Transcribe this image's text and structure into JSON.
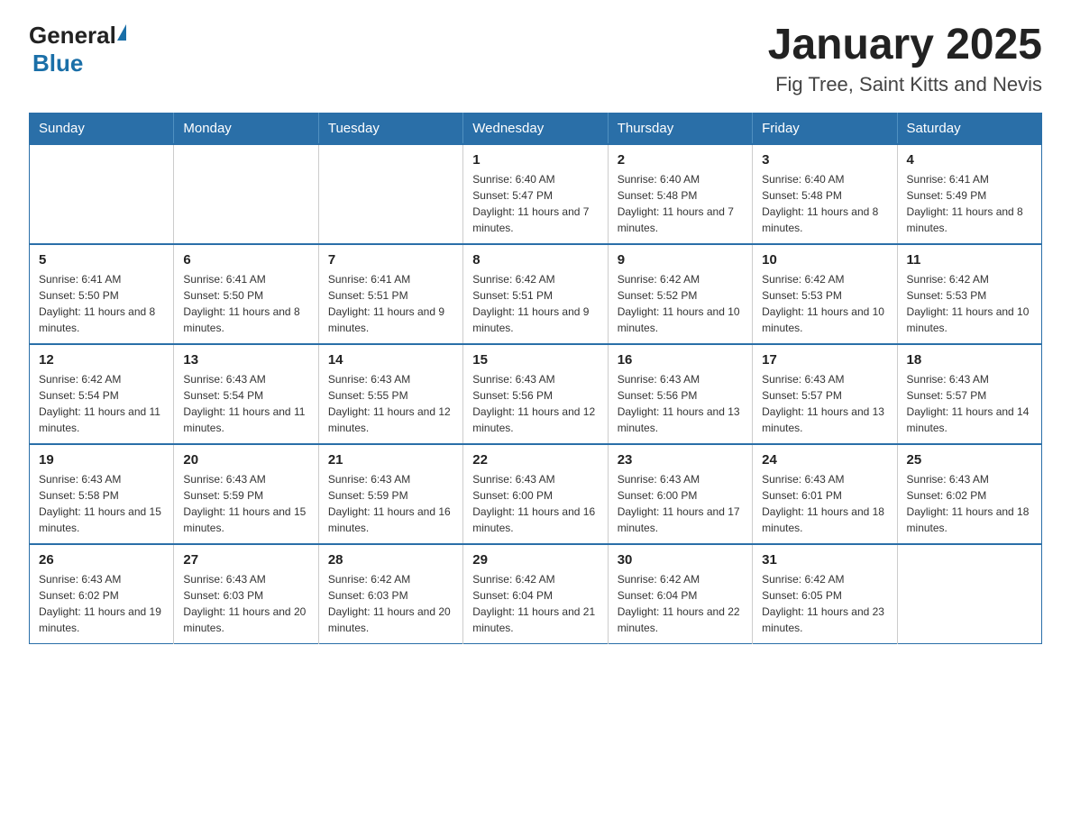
{
  "logo": {
    "general": "General",
    "blue": "Blue"
  },
  "header": {
    "month": "January 2025",
    "location": "Fig Tree, Saint Kitts and Nevis"
  },
  "days_of_week": [
    "Sunday",
    "Monday",
    "Tuesday",
    "Wednesday",
    "Thursday",
    "Friday",
    "Saturday"
  ],
  "weeks": [
    [
      {
        "day": "",
        "info": ""
      },
      {
        "day": "",
        "info": ""
      },
      {
        "day": "",
        "info": ""
      },
      {
        "day": "1",
        "info": "Sunrise: 6:40 AM\nSunset: 5:47 PM\nDaylight: 11 hours and 7 minutes."
      },
      {
        "day": "2",
        "info": "Sunrise: 6:40 AM\nSunset: 5:48 PM\nDaylight: 11 hours and 7 minutes."
      },
      {
        "day": "3",
        "info": "Sunrise: 6:40 AM\nSunset: 5:48 PM\nDaylight: 11 hours and 8 minutes."
      },
      {
        "day": "4",
        "info": "Sunrise: 6:41 AM\nSunset: 5:49 PM\nDaylight: 11 hours and 8 minutes."
      }
    ],
    [
      {
        "day": "5",
        "info": "Sunrise: 6:41 AM\nSunset: 5:50 PM\nDaylight: 11 hours and 8 minutes."
      },
      {
        "day": "6",
        "info": "Sunrise: 6:41 AM\nSunset: 5:50 PM\nDaylight: 11 hours and 8 minutes."
      },
      {
        "day": "7",
        "info": "Sunrise: 6:41 AM\nSunset: 5:51 PM\nDaylight: 11 hours and 9 minutes."
      },
      {
        "day": "8",
        "info": "Sunrise: 6:42 AM\nSunset: 5:51 PM\nDaylight: 11 hours and 9 minutes."
      },
      {
        "day": "9",
        "info": "Sunrise: 6:42 AM\nSunset: 5:52 PM\nDaylight: 11 hours and 10 minutes."
      },
      {
        "day": "10",
        "info": "Sunrise: 6:42 AM\nSunset: 5:53 PM\nDaylight: 11 hours and 10 minutes."
      },
      {
        "day": "11",
        "info": "Sunrise: 6:42 AM\nSunset: 5:53 PM\nDaylight: 11 hours and 10 minutes."
      }
    ],
    [
      {
        "day": "12",
        "info": "Sunrise: 6:42 AM\nSunset: 5:54 PM\nDaylight: 11 hours and 11 minutes."
      },
      {
        "day": "13",
        "info": "Sunrise: 6:43 AM\nSunset: 5:54 PM\nDaylight: 11 hours and 11 minutes."
      },
      {
        "day": "14",
        "info": "Sunrise: 6:43 AM\nSunset: 5:55 PM\nDaylight: 11 hours and 12 minutes."
      },
      {
        "day": "15",
        "info": "Sunrise: 6:43 AM\nSunset: 5:56 PM\nDaylight: 11 hours and 12 minutes."
      },
      {
        "day": "16",
        "info": "Sunrise: 6:43 AM\nSunset: 5:56 PM\nDaylight: 11 hours and 13 minutes."
      },
      {
        "day": "17",
        "info": "Sunrise: 6:43 AM\nSunset: 5:57 PM\nDaylight: 11 hours and 13 minutes."
      },
      {
        "day": "18",
        "info": "Sunrise: 6:43 AM\nSunset: 5:57 PM\nDaylight: 11 hours and 14 minutes."
      }
    ],
    [
      {
        "day": "19",
        "info": "Sunrise: 6:43 AM\nSunset: 5:58 PM\nDaylight: 11 hours and 15 minutes."
      },
      {
        "day": "20",
        "info": "Sunrise: 6:43 AM\nSunset: 5:59 PM\nDaylight: 11 hours and 15 minutes."
      },
      {
        "day": "21",
        "info": "Sunrise: 6:43 AM\nSunset: 5:59 PM\nDaylight: 11 hours and 16 minutes."
      },
      {
        "day": "22",
        "info": "Sunrise: 6:43 AM\nSunset: 6:00 PM\nDaylight: 11 hours and 16 minutes."
      },
      {
        "day": "23",
        "info": "Sunrise: 6:43 AM\nSunset: 6:00 PM\nDaylight: 11 hours and 17 minutes."
      },
      {
        "day": "24",
        "info": "Sunrise: 6:43 AM\nSunset: 6:01 PM\nDaylight: 11 hours and 18 minutes."
      },
      {
        "day": "25",
        "info": "Sunrise: 6:43 AM\nSunset: 6:02 PM\nDaylight: 11 hours and 18 minutes."
      }
    ],
    [
      {
        "day": "26",
        "info": "Sunrise: 6:43 AM\nSunset: 6:02 PM\nDaylight: 11 hours and 19 minutes."
      },
      {
        "day": "27",
        "info": "Sunrise: 6:43 AM\nSunset: 6:03 PM\nDaylight: 11 hours and 20 minutes."
      },
      {
        "day": "28",
        "info": "Sunrise: 6:42 AM\nSunset: 6:03 PM\nDaylight: 11 hours and 20 minutes."
      },
      {
        "day": "29",
        "info": "Sunrise: 6:42 AM\nSunset: 6:04 PM\nDaylight: 11 hours and 21 minutes."
      },
      {
        "day": "30",
        "info": "Sunrise: 6:42 AM\nSunset: 6:04 PM\nDaylight: 11 hours and 22 minutes."
      },
      {
        "day": "31",
        "info": "Sunrise: 6:42 AM\nSunset: 6:05 PM\nDaylight: 11 hours and 23 minutes."
      },
      {
        "day": "",
        "info": ""
      }
    ]
  ]
}
